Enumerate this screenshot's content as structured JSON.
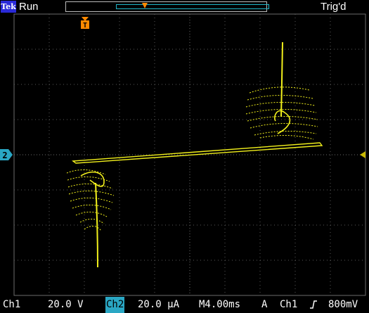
{
  "brand": {
    "label": "Tek"
  },
  "status": {
    "run": "Run",
    "trigger": "Trig'd"
  },
  "markers": {
    "trigger_position": "T",
    "channel2_ground": "2"
  },
  "bottom": {
    "ch1_label": "Ch1",
    "ch1_scale": "20.0 V",
    "ch2_label": "Ch2",
    "ch2_scale": "20.0 µA",
    "timebase": "M4.00ms",
    "trigger_mode": "A",
    "trigger_source": "Ch1",
    "trigger_slope_icon": "rising-edge-icon",
    "trigger_level": "800mV"
  },
  "colors": {
    "trace": "#f2f01c",
    "marker": "#ff8a00",
    "ch2": "#2aa7c4",
    "grid": "#6b6b6b"
  },
  "display": {
    "mode": "XY",
    "divisions": [
      10,
      8
    ]
  }
}
